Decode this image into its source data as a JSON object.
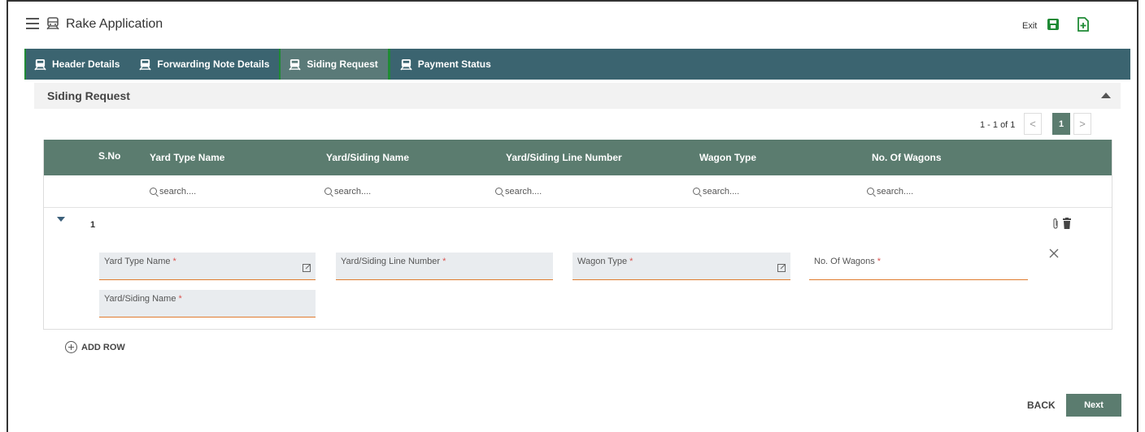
{
  "app": {
    "title": "Rake Application",
    "exit_label": "Exit"
  },
  "tabs": [
    {
      "label": "Header Details"
    },
    {
      "label": "Forwarding Note Details"
    },
    {
      "label": "Siding Request"
    },
    {
      "label": "Payment Status"
    }
  ],
  "active_tab": "Siding Request",
  "section": {
    "title": "Siding Request"
  },
  "pagination": {
    "info": "1 - 1 of 1",
    "current_page": "1",
    "prev": "<",
    "next": ">"
  },
  "grid": {
    "columns": [
      "S.No",
      "Yard Type Name",
      "Yard/Siding Name",
      "Yard/Siding Line Number",
      "Wagon Type",
      "No. Of Wagons"
    ],
    "filter_placeholder": "search....",
    "rows": [
      {
        "sno": "1",
        "fields": [
          {
            "label": "Yard Type Name",
            "value": ""
          },
          {
            "label": "Yard/Siding Line Number",
            "value": ""
          },
          {
            "label": "Wagon Type",
            "value": ""
          },
          {
            "label": "No. Of Wagons",
            "value": ""
          },
          {
            "label": "Yard/Siding Name",
            "value": ""
          }
        ]
      }
    ]
  },
  "required_mark": "*",
  "actions": {
    "add_row": "ADD ROW",
    "back": "BACK",
    "next": "Next"
  },
  "colors": {
    "tab_bar": "#3b6470",
    "grid_header": "#5b7c6f",
    "accent_green": "#1f8a35",
    "field_underline": "#e07b2e"
  }
}
